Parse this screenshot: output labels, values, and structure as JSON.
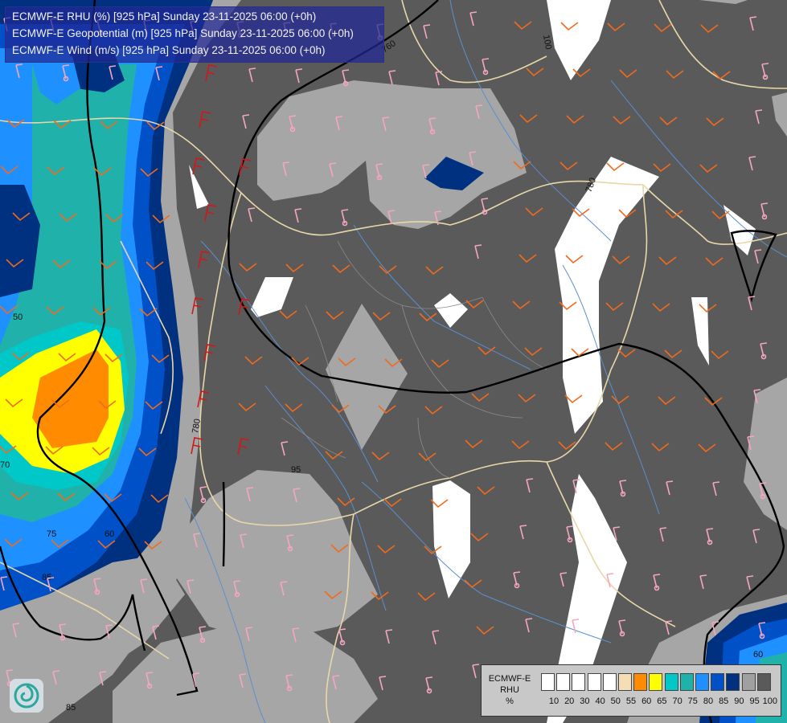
{
  "title_lines": [
    "ECMWF-E RHU (%) [925 hPa] Sunday 23-11-2025 06:00 (+0h)",
    "ECMWF-E Geopotential (m) [925 hPa] Sunday 23-11-2025 06:00 (+0h)",
    "ECMWF-E Wind (m/s) [925 hPa] Sunday 23-11-2025 06:00 (+0h)"
  ],
  "legend": {
    "model": "ECMWF-E",
    "variable": "RHU",
    "unit": "%",
    "ticks": [
      "10",
      "20",
      "30",
      "40",
      "50",
      "55",
      "60",
      "65",
      "70",
      "75",
      "80",
      "85",
      "90",
      "95",
      "100"
    ],
    "colors": [
      "#ffffff",
      "#ffffff",
      "#ffffff",
      "#ffffff",
      "#ffffff",
      "#f5deb3",
      "#ff8c00",
      "#ffff00",
      "#00c8c8",
      "#20b2aa",
      "#1e90ff",
      "#0050c8",
      "#003080",
      "#a0a0a0",
      "#5a5a5a"
    ]
  },
  "geopotential_labels": [
    "760",
    "780",
    "780",
    "100"
  ],
  "rhu_labels": [
    "50",
    "50",
    "75",
    "60",
    "85",
    "85",
    "95",
    "70",
    "95",
    "60"
  ],
  "logo": {
    "icon": "ecmwf-swirl-icon"
  },
  "colors": {
    "background_dark_gray": "#5a5a5a",
    "light_gray": "#a6a6a6",
    "river": "#5a8fd0",
    "border_beige": "#e8d7a8",
    "barb_pink": "#f4a6c0",
    "barb_orange": "#f26a1b",
    "barb_red": "#d01818"
  }
}
